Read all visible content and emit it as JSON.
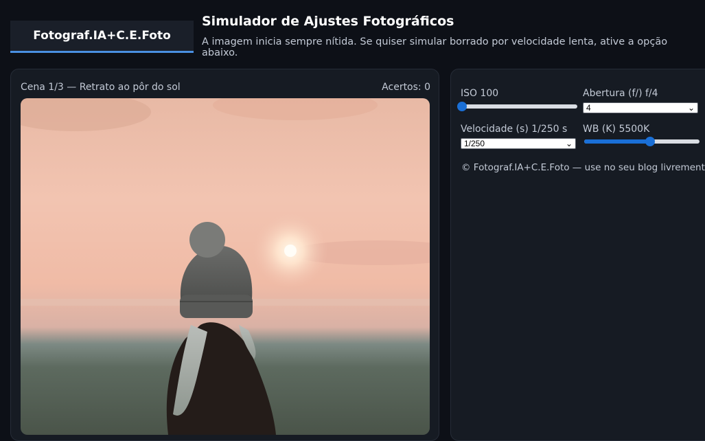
{
  "header": {
    "logo": "Fotograf.IA+C.E.Foto",
    "title": "Simulador de Ajustes Fotográficos",
    "subtitle": "A imagem inicia sempre nítida. Se quiser simular borrado por velocidade lenta, ative a opção abaixo."
  },
  "scene": {
    "label": "Cena 1/3 — Retrato ao pôr do sol",
    "score": "Acertos: 0"
  },
  "controls": {
    "iso": {
      "label": "ISO 100",
      "level": 0.0
    },
    "aperture": {
      "label": "Abertura (f/) f/4",
      "value": "4"
    },
    "shutter": {
      "label": "Velocidade (s) 1/250 s",
      "value": "1/250"
    },
    "wb": {
      "label": "WB (K) 5500K",
      "level": 0.57
    },
    "footer": "© Fotograf.IA+C.E.Foto — use no seu blog livremente."
  },
  "colors": {
    "accent": "#1a6fd6",
    "tab_underline": "#4a90e2",
    "background": "#0d1017"
  }
}
